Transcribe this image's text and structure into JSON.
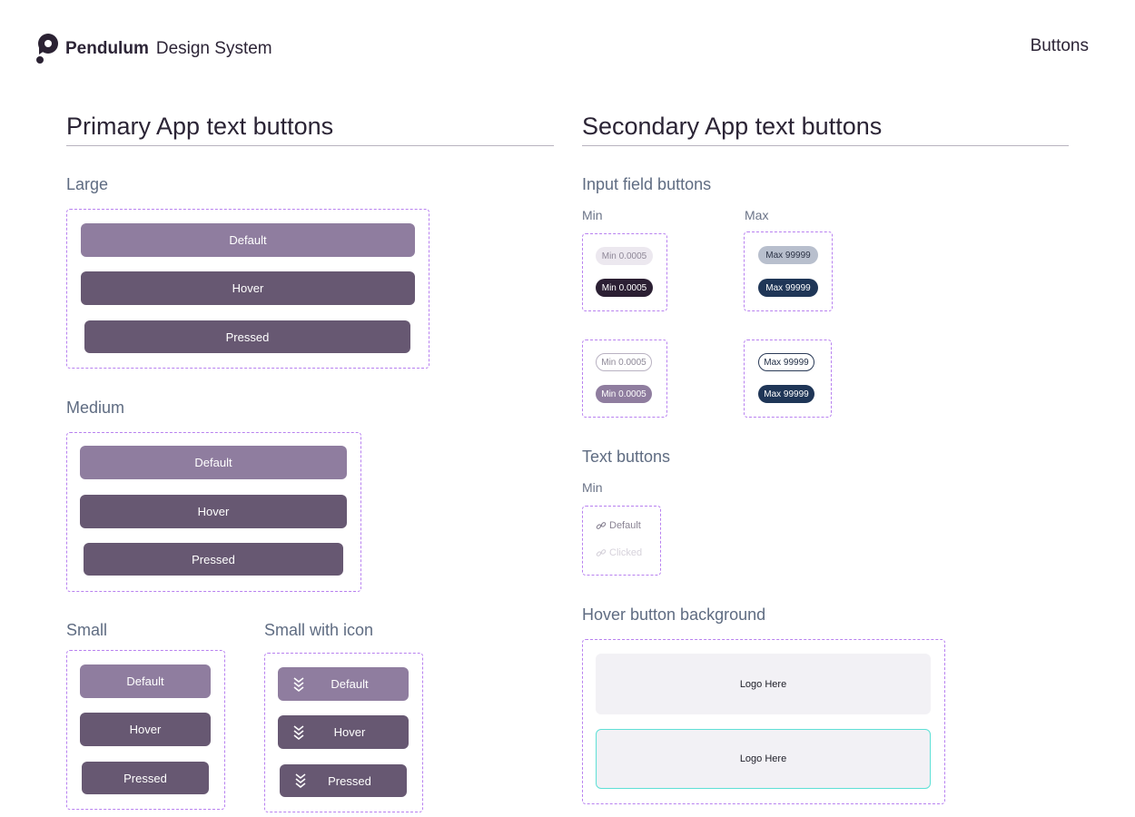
{
  "header": {
    "brand_name": "Pendulum",
    "brand_sub": "Design System",
    "page_tag": "Buttons"
  },
  "primary": {
    "title": "Primary App text buttons",
    "large": {
      "label": "Large",
      "default": "Default",
      "hover": "Hover",
      "pressed": "Pressed"
    },
    "medium": {
      "label": "Medium",
      "default": "Default",
      "hover": "Hover",
      "pressed": "Pressed"
    },
    "small": {
      "label": "Small",
      "default": "Default",
      "hover": "Hover",
      "pressed": "Pressed"
    },
    "small_icon": {
      "label": "Small with icon",
      "default": "Default",
      "hover": "Hover",
      "pressed": "Pressed",
      "icon": "stacked-chevrons-icon"
    }
  },
  "secondary": {
    "title": "Secondary App text buttons",
    "input_field": {
      "label": "Input field buttons",
      "min_label": "Min",
      "max_label": "Max",
      "min_text": "Min 0.0005",
      "max_text": "Max 99999"
    },
    "text_buttons": {
      "label": "Text buttons",
      "min_label": "Min",
      "default": "Default",
      "clicked": "Clicked",
      "icon": "link-icon"
    },
    "hover_bg": {
      "label": "Hover button background",
      "logo_text": "Logo Here",
      "accent": "#5fe0d6"
    }
  },
  "colors": {
    "default": "#8f7d9f",
    "hover": "#675872",
    "dashed_outline": "#b881f0",
    "navy": "#1f3657"
  }
}
